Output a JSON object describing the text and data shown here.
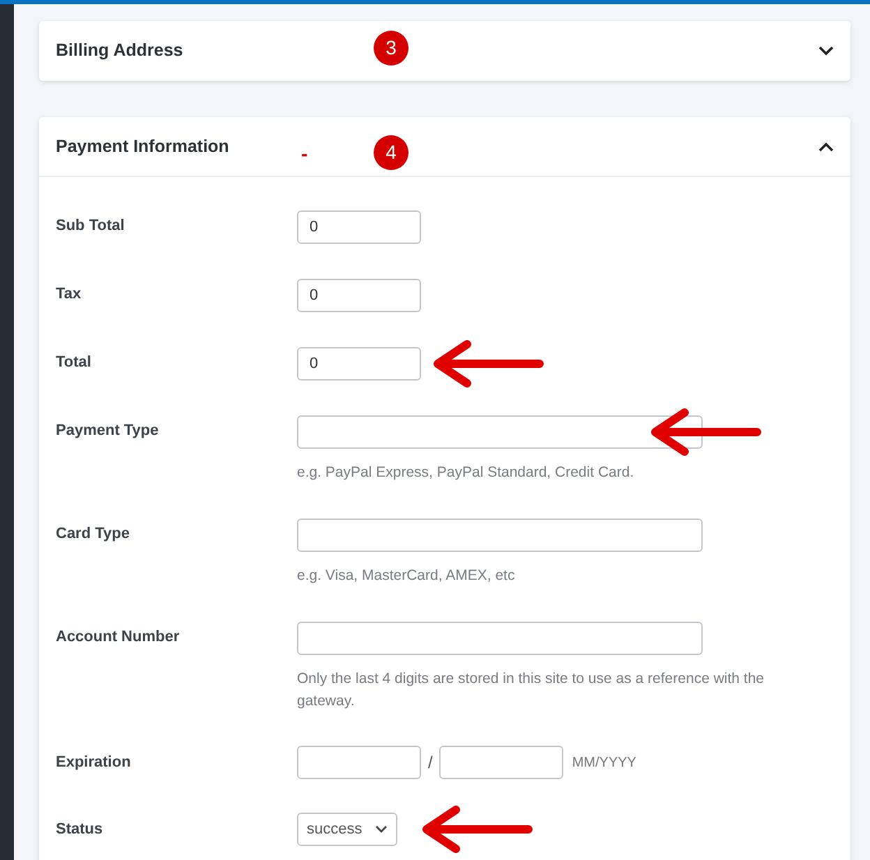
{
  "sections": [
    {
      "title": "Billing Address",
      "expanded": false,
      "badge": "3"
    },
    {
      "title": "Payment Information",
      "expanded": true,
      "badge": "4",
      "mark": "-",
      "fields": [
        {
          "kind": "small",
          "label": "Sub Total",
          "value": "0",
          "arrow": false
        },
        {
          "kind": "small",
          "label": "Tax",
          "value": "0",
          "arrow": false
        },
        {
          "kind": "small",
          "label": "Total",
          "value": "0",
          "arrow": true
        },
        {
          "kind": "text",
          "label": "Payment Type",
          "hint": "e.g. PayPal Express, PayPal Standard, Credit Card.",
          "arrow": true
        },
        {
          "kind": "text",
          "label": "Card Type",
          "hint": "e.g. Visa, MasterCard, AMEX, etc",
          "arrow": false
        },
        {
          "kind": "text",
          "label": "Account Number",
          "hint": "Only the last 4 digits are stored in this site to use as a reference with the gateway.",
          "arrow": false
        },
        {
          "kind": "expiration",
          "label": "Expiration",
          "separator": "/",
          "format": "MM/YYYY",
          "arrow": false
        },
        {
          "kind": "select",
          "label": "Status",
          "value": "success",
          "arrow": true
        }
      ]
    }
  ]
}
